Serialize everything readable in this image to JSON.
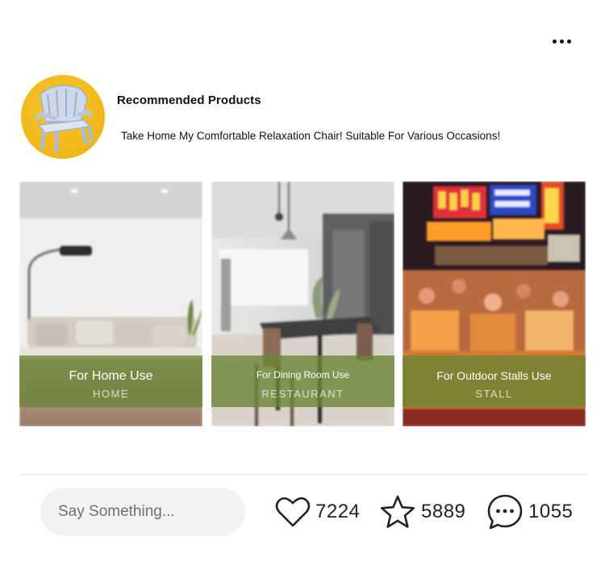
{
  "menu": {
    "icon": "more-horizontal-icon"
  },
  "header": {
    "avatar_icon": "plastic-chair-icon",
    "accent_color": "#f2bb1f",
    "title": "Recommended Products",
    "subtitle": "Take Home My Comfortable Relaxation Chair! Suitable For Various Occasions!"
  },
  "cards": [
    {
      "title": "For Home Use",
      "subtitle": "HOME"
    },
    {
      "title": "For Dining Room Use",
      "subtitle": "RESTAURANT"
    },
    {
      "title": "For Outdoor Stalls Use",
      "subtitle": "STALL"
    }
  ],
  "overlay_color": "#68843a",
  "footer": {
    "comment_placeholder": "Say Something...",
    "likes": {
      "icon": "heart-icon",
      "count": "7224"
    },
    "favorites": {
      "icon": "star-icon",
      "count": "5889"
    },
    "comments": {
      "icon": "chat-bubble-icon",
      "count": "1055"
    }
  }
}
